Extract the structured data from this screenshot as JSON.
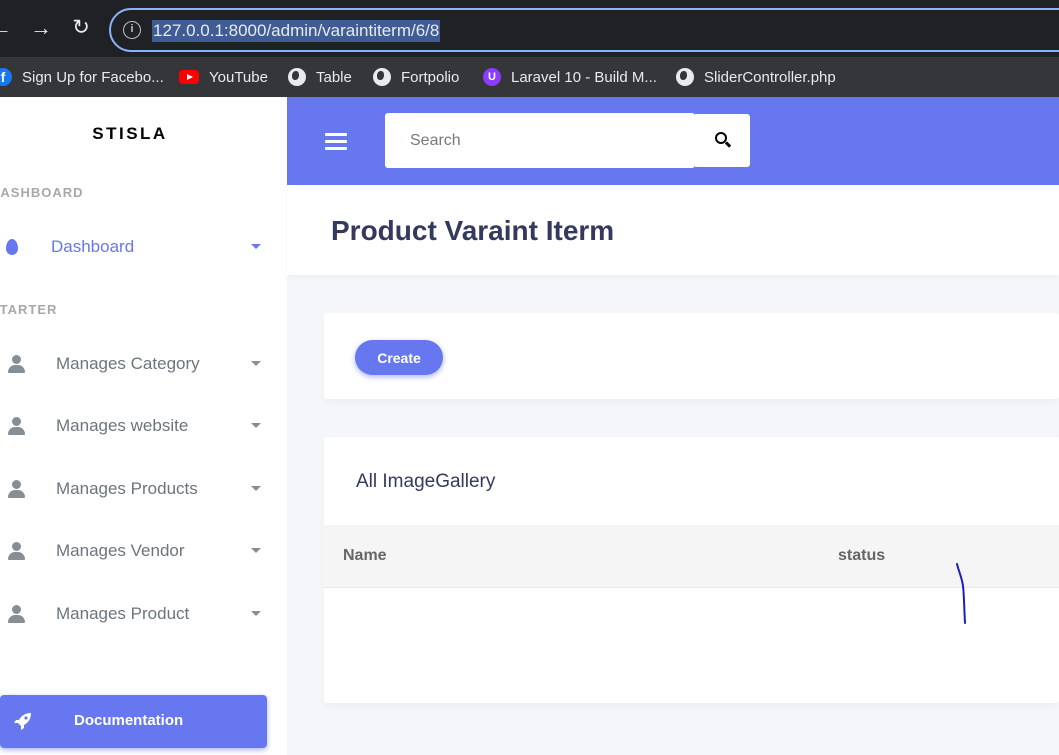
{
  "browser": {
    "url": "127.0.0.1:8000/admin/varaintiterm/6/8",
    "bookmarks": [
      {
        "label": "Sign Up for Facebo...",
        "icon": "facebook-icon"
      },
      {
        "label": "YouTube",
        "icon": "youtube-icon"
      },
      {
        "label": "Table",
        "icon": "globe-icon"
      },
      {
        "label": "Fortpolio",
        "icon": "globe-icon"
      },
      {
        "label": "Laravel 10 - Build M...",
        "icon": "laravel-icon"
      },
      {
        "label": "SliderController.php",
        "icon": "globe-icon"
      }
    ]
  },
  "sidebar": {
    "brand": "STISLA",
    "header_dashboard": "DASHBOARD",
    "header_starter": "STARTER",
    "dashboard_label": "Dashboard",
    "items": [
      {
        "label": "Manages Category"
      },
      {
        "label": "Manages website"
      },
      {
        "label": "Manages Products"
      },
      {
        "label": "Manages Vendor"
      },
      {
        "label": "Manages Product"
      }
    ],
    "documentation": "Documentation"
  },
  "navbar": {
    "search_placeholder": "Search"
  },
  "main": {
    "page_title": "Product Varaint Iterm",
    "create_label": "Create",
    "card_title": "All ImageGallery",
    "columns": [
      "Name",
      "status"
    ]
  },
  "colors": {
    "primary": "#6777ef",
    "title": "#34395e"
  }
}
